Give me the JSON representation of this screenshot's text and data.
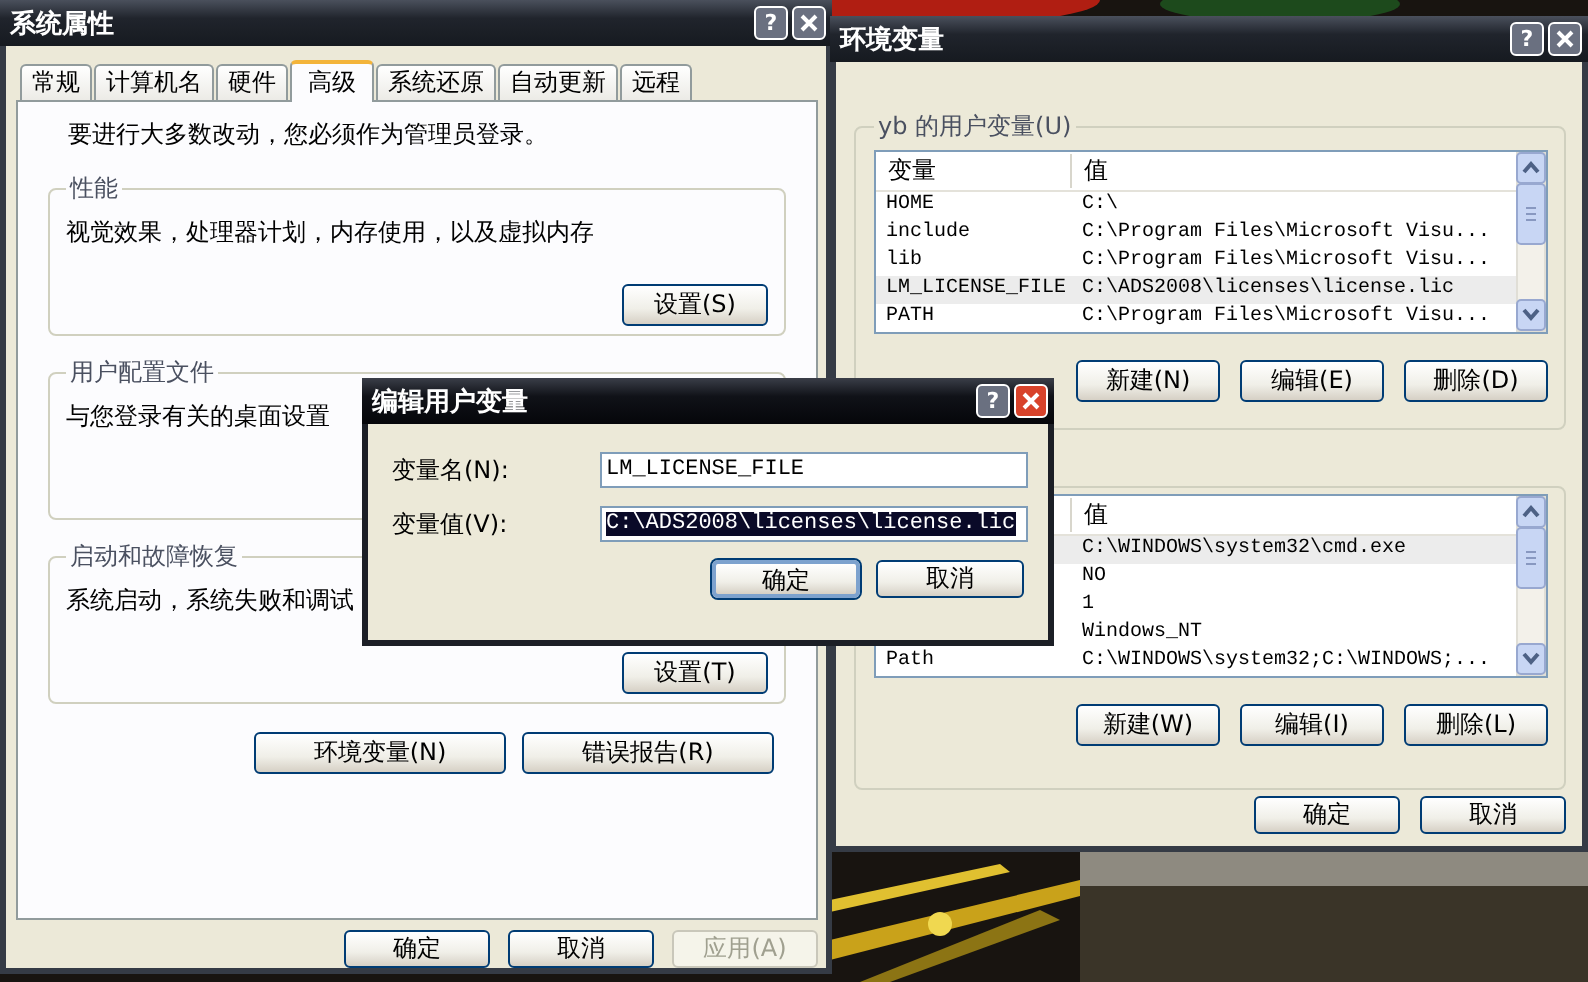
{
  "system_properties": {
    "title": "系统属性",
    "active": false,
    "help": "?",
    "tabs": [
      {
        "label": "常规",
        "selected": false
      },
      {
        "label": "计算机名",
        "selected": false
      },
      {
        "label": "硬件",
        "selected": false
      },
      {
        "label": "高级",
        "selected": true
      },
      {
        "label": "系统还原",
        "selected": false
      },
      {
        "label": "自动更新",
        "selected": false
      },
      {
        "label": "远程",
        "selected": false
      }
    ],
    "notice": "要进行大多数改动，您必须作为管理员登录。",
    "groups": [
      {
        "title": "性能",
        "text": "视觉效果，处理器计划，内存使用，以及虚拟内存",
        "button": "设置(S)"
      },
      {
        "title": "用户配置文件",
        "text": "与您登录有关的桌面设置"
      },
      {
        "title": "启动和故障恢复",
        "text": "系统启动，系统失败和调试",
        "button": "设置(T)"
      }
    ],
    "buttons": [
      "环境变量(N)",
      "错误报告(R)"
    ],
    "footer_buttons": [
      {
        "label": "确定",
        "disabled": false
      },
      {
        "label": "取消",
        "disabled": false
      },
      {
        "label": "应用(A)",
        "disabled": true
      }
    ]
  },
  "environment_variables": {
    "title": "环境变量",
    "active": false,
    "help": "?",
    "user_group": {
      "title": "yb 的用户变量(U)",
      "name_header": "变量",
      "value_header": "值",
      "rows": [
        {
          "name": "HOME",
          "value": "C:\\",
          "selected": false
        },
        {
          "name": "include",
          "value": "C:\\Program Files\\Microsoft Visu...",
          "selected": false
        },
        {
          "name": "lib",
          "value": "C:\\Program Files\\Microsoft Visu...",
          "selected": false
        },
        {
          "name": "LM_LICENSE_FILE",
          "value": "C:\\ADS2008\\licenses\\license.lic",
          "selected": true
        },
        {
          "name": "PATH",
          "value": "C:\\Program Files\\Microsoft Visu...",
          "selected": false
        }
      ],
      "buttons": [
        "新建(N)",
        "编辑(E)",
        "删除(D)"
      ]
    },
    "system_group": {
      "value_header": "值",
      "rows": [
        {
          "value": "C:\\WINDOWS\\system32\\cmd.exe",
          "selected": true
        },
        {
          "value": "NO",
          "selected": false
        },
        {
          "value": "1",
          "selected": false
        },
        {
          "value": "Windows_NT",
          "selected": false
        },
        {
          "name": "Path",
          "value": "C:\\WINDOWS\\system32;C:\\WINDOWS;...",
          "selected": false
        }
      ],
      "buttons": [
        "新建(W)",
        "编辑(I)",
        "删除(L)"
      ]
    },
    "footer_buttons": [
      "确定",
      "取消"
    ]
  },
  "edit_dialog": {
    "title": "编辑用户变量",
    "active": true,
    "help": "?",
    "fields": [
      {
        "label": "变量名(N):",
        "value": "LM_LICENSE_FILE",
        "text_selected": false
      },
      {
        "label": "变量值(V):",
        "value": "C:\\ADS2008\\licenses\\license.lic",
        "text_selected": true
      }
    ],
    "buttons": [
      {
        "label": "确定",
        "default": true
      },
      {
        "label": "取消",
        "default": false
      }
    ]
  }
}
